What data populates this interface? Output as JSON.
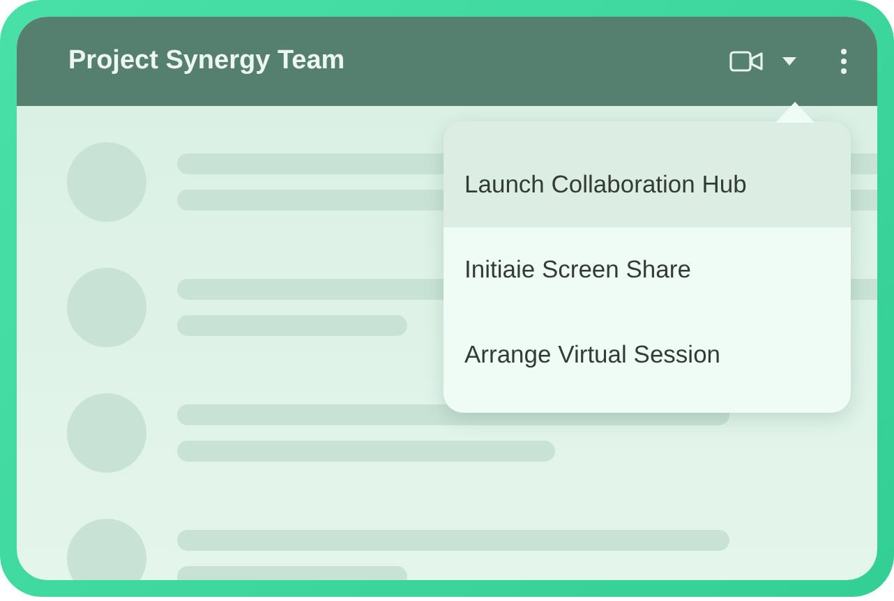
{
  "header": {
    "title": "Project Synergy Team"
  },
  "list": {
    "rows": [
      {
        "kind": "placeholder"
      },
      {
        "kind": "placeholder"
      },
      {
        "kind": "placeholder"
      },
      {
        "kind": "placeholder"
      }
    ]
  },
  "menu": {
    "items": [
      {
        "label": "Launch Collaboration Hub",
        "selected": true
      },
      {
        "label": "Initiaie Screen Share",
        "selected": false
      },
      {
        "label": "Arrange Virtual Session",
        "selected": false
      }
    ]
  }
}
